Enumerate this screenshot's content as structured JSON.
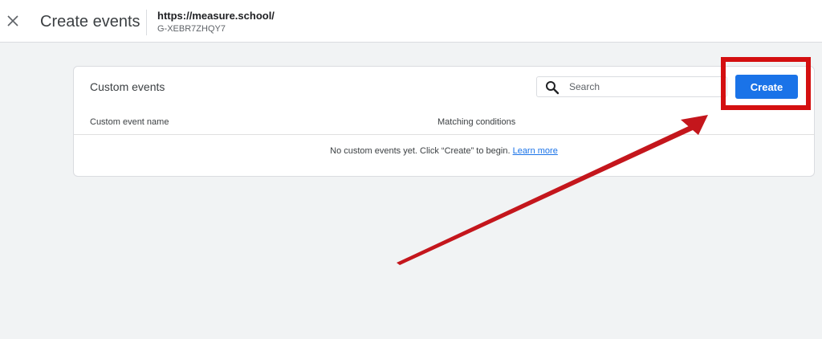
{
  "header": {
    "close_icon": "close-icon",
    "title": "Create events",
    "property_url": "https://measure.school/",
    "property_id": "G-XEBR7ZHQY7"
  },
  "card": {
    "title": "Custom events",
    "search": {
      "icon": "search-icon",
      "placeholder": "Search",
      "value": ""
    },
    "create_label": "Create",
    "columns": [
      "Custom event name",
      "Matching conditions"
    ],
    "empty_text": "No custom events yet. Click “Create” to begin.",
    "learn_more": "Learn more"
  },
  "colors": {
    "background": "#f1f3f4",
    "primary_button": "#1a73e8",
    "link": "#1a73e8",
    "annotation": "#d40f10"
  }
}
